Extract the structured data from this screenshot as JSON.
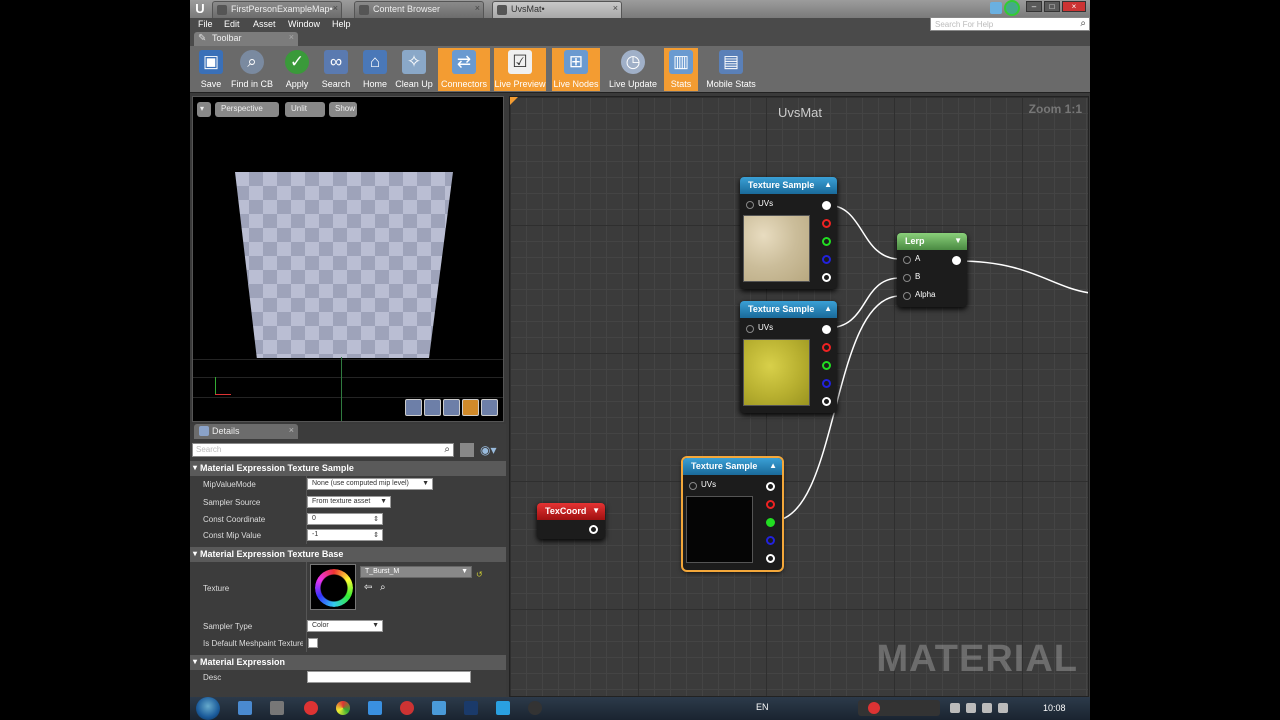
{
  "tabs": [
    {
      "label": "FirstPersonExampleMap•",
      "active": false
    },
    {
      "label": "Content Browser",
      "active": false
    },
    {
      "label": "UvsMat•",
      "active": true
    }
  ],
  "menu": [
    "File",
    "Edit",
    "Asset",
    "Window",
    "Help"
  ],
  "search": {
    "placeholder": "Search For Help"
  },
  "toolbar": {
    "tab_label": "Toolbar",
    "buttons": [
      {
        "label": "Save",
        "icon": "save-icon",
        "on": false
      },
      {
        "label": "Find in CB",
        "icon": "magnifier-icon",
        "on": false
      },
      {
        "label": "Apply",
        "icon": "checkmark-icon",
        "on": false
      },
      {
        "label": "Search",
        "icon": "binoculars-icon",
        "on": false
      },
      {
        "label": "Home",
        "icon": "home-icon",
        "on": false
      },
      {
        "label": "Clean Up",
        "icon": "broom-icon",
        "on": false
      },
      {
        "label": "Connectors",
        "icon": "connectors-icon",
        "on": true
      },
      {
        "label": "Live Preview",
        "icon": "live-preview-icon",
        "on": true
      },
      {
        "label": "Live Nodes",
        "icon": "live-nodes-icon",
        "on": true
      },
      {
        "label": "Live Update",
        "icon": "live-update-icon",
        "on": false
      },
      {
        "label": "Stats",
        "icon": "stats-icon",
        "on": true
      },
      {
        "label": "Mobile Stats",
        "icon": "mobile-stats-icon",
        "on": false
      }
    ]
  },
  "viewport": {
    "perspective": "Perspective",
    "unlit": "Unlit",
    "show": "Show"
  },
  "details": {
    "tab_label": "Details",
    "search_placeholder": "Search",
    "sec1": "Material Expression Texture Sample",
    "mip_mode_label": "MipValueMode",
    "mip_mode_value": "None (use computed mip level)",
    "sampler_source_label": "Sampler Source",
    "sampler_source_value": "From texture asset",
    "const_coord_label": "Const Coordinate",
    "const_coord_value": "0",
    "const_mip_label": "Const Mip Value",
    "const_mip_value": "-1",
    "sec2": "Material Expression Texture Base",
    "texture_label": "Texture",
    "texture_value": "T_Burst_M",
    "sampler_type_label": "Sampler Type",
    "sampler_type_value": "Color",
    "meshpaint_label": "Is Default Meshpaint Texture",
    "sec3": "Material Expression",
    "desc_label": "Desc",
    "desc_value": ""
  },
  "graph": {
    "title": "UvsMat",
    "zoom": "Zoom 1:1",
    "watermark": "MATERIAL",
    "nodes": {
      "ts1": {
        "title": "Texture Sample",
        "input": "UVs"
      },
      "ts2": {
        "title": "Texture Sample",
        "input": "UVs"
      },
      "ts3": {
        "title": "Texture Sample",
        "input": "UVs"
      },
      "lerp": {
        "title": "Lerp",
        "a": "A",
        "b": "B",
        "alpha": "Alpha"
      },
      "texcoord": {
        "title": "TexCoord"
      }
    }
  },
  "taskbar": {
    "lang": "EN",
    "clock": "10:08"
  }
}
